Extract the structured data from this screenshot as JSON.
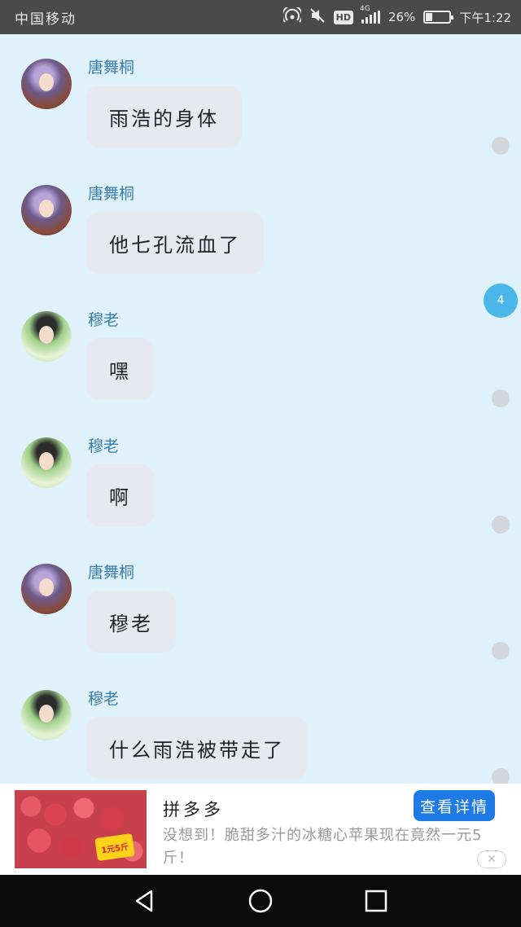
{
  "status_bar": {
    "carrier": "中国移动",
    "hd": "HD",
    "network": "4G",
    "battery": "26%",
    "battery_level": 0.26,
    "time": "下午1:22"
  },
  "messages": [
    {
      "sender": "唐舞桐",
      "avatar": "tang",
      "text": "雨浩的身体"
    },
    {
      "sender": "唐舞桐",
      "avatar": "tang",
      "text": "他七孔流血了"
    },
    {
      "sender": "穆老",
      "avatar": "mu",
      "text": "嘿"
    },
    {
      "sender": "穆老",
      "avatar": "mu",
      "text": "啊"
    },
    {
      "sender": "唐舞桐",
      "avatar": "tang",
      "text": "穆老"
    },
    {
      "sender": "穆老",
      "avatar": "mu",
      "text": "什么雨浩被带走了"
    }
  ],
  "floating_badge": "4",
  "ad": {
    "title": "拼多多",
    "description": "没想到！脆甜多汁的冰糖心苹果现在竟然一元5斤！",
    "button": "查看详情",
    "sticker": "1元5斤",
    "close_symbol": "✕"
  },
  "icons": {
    "hotspot": "hotspot-icon",
    "mute": "mute-icon",
    "back": "back-icon",
    "home": "home-icon",
    "recent": "recent-apps-icon"
  }
}
